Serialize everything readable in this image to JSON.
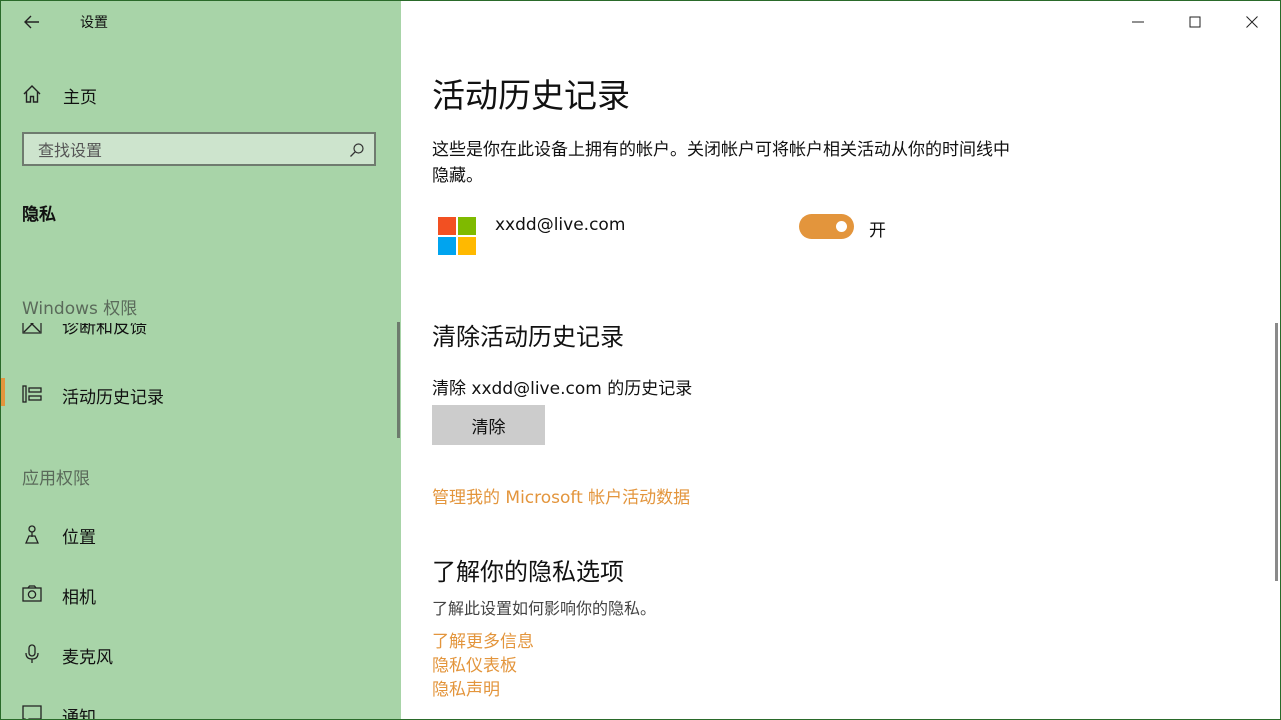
{
  "window": {
    "title": "设置"
  },
  "sidebar": {
    "home_label": "主页",
    "search_placeholder": "查找设置",
    "section_title": "隐私",
    "groups": {
      "windows": "Windows 权限",
      "apps": "应用权限"
    },
    "items": {
      "diagnostics": {
        "label": "诊断和反馈",
        "icon": "diagnostics-icon"
      },
      "activity_history": {
        "label": "活动历史记录",
        "icon": "timeline-icon",
        "selected": true
      },
      "location": {
        "label": "位置",
        "icon": "location-icon"
      },
      "camera": {
        "label": "相机",
        "icon": "camera-icon"
      },
      "microphone": {
        "label": "麦克风",
        "icon": "microphone-icon"
      },
      "notifications": {
        "label": "通知",
        "icon": "notification-icon"
      }
    }
  },
  "main": {
    "title": "活动历史记录",
    "description": "这些是你在此设备上拥有的帐户。关闭帐户可将帐户相关活动从你的时间线中隐藏。",
    "account": {
      "email": "xxdd@live.com",
      "toggle_state": "开",
      "toggle_on": true
    },
    "clear_section": {
      "heading": "清除活动历史记录",
      "text": "清除 xxdd@live.com 的历史记录",
      "button": "清除"
    },
    "manage_link": "管理我的 Microsoft 帐户活动数据",
    "privacy_section": {
      "heading": "了解你的隐私选项",
      "hint": "了解此设置如何影响你的隐私。",
      "links": [
        "了解更多信息",
        "隐私仪表板",
        "隐私声明"
      ]
    }
  },
  "colors": {
    "sidebar_bg": "#a8d4a8",
    "accent": "#e3953c",
    "ms_red": "#f25022",
    "ms_green": "#7fba00",
    "ms_blue": "#00a4ef",
    "ms_yellow": "#ffb900"
  }
}
